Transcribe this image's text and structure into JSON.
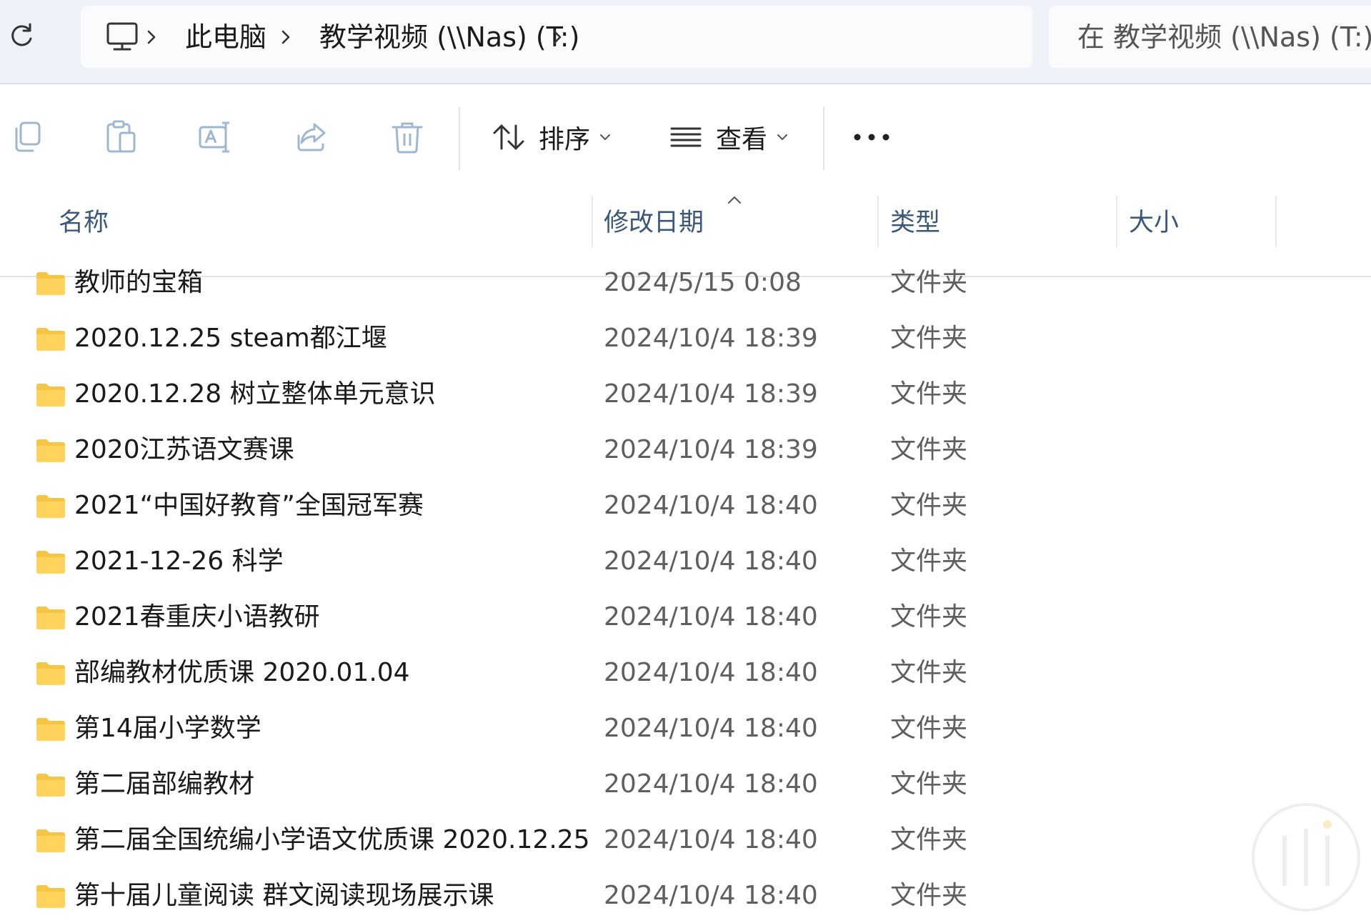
{
  "address_bar": {
    "breadcrumb": [
      "此电脑",
      "教学视频 (\\\\Nas) (T:)"
    ],
    "search_placeholder": "在 教学视频 (\\\\Nas) (T:)"
  },
  "toolbar": {
    "sort_label": "排序",
    "view_label": "查看"
  },
  "columns": {
    "name": "名称",
    "modified": "修改日期",
    "type": "类型",
    "size": "大小"
  },
  "files": [
    {
      "name": "教师的宝箱",
      "modified": "2024/5/15 0:08",
      "type": "文件夹",
      "size": ""
    },
    {
      "name": "2020.12.25 steam都江堰",
      "modified": "2024/10/4 18:39",
      "type": "文件夹",
      "size": ""
    },
    {
      "name": "2020.12.28 树立整体单元意识",
      "modified": "2024/10/4 18:39",
      "type": "文件夹",
      "size": ""
    },
    {
      "name": "2020江苏语文赛课",
      "modified": "2024/10/4 18:39",
      "type": "文件夹",
      "size": ""
    },
    {
      "name": "2021“中国好教育”全国冠军赛",
      "modified": "2024/10/4 18:40",
      "type": "文件夹",
      "size": ""
    },
    {
      "name": "2021-12-26 科学",
      "modified": "2024/10/4 18:40",
      "type": "文件夹",
      "size": ""
    },
    {
      "name": "2021春重庆小语教研",
      "modified": "2024/10/4 18:40",
      "type": "文件夹",
      "size": ""
    },
    {
      "name": "部编教材优质课 2020.01.04",
      "modified": "2024/10/4 18:40",
      "type": "文件夹",
      "size": ""
    },
    {
      "name": "第14届小学数学",
      "modified": "2024/10/4 18:40",
      "type": "文件夹",
      "size": ""
    },
    {
      "name": "第二届部编教材",
      "modified": "2024/10/4 18:40",
      "type": "文件夹",
      "size": ""
    },
    {
      "name": "第二届全国统编小学语文优质课 2020.12.25",
      "modified": "2024/10/4 18:40",
      "type": "文件夹",
      "size": ""
    },
    {
      "name": "第十届儿童阅读 群文阅读现场展示课",
      "modified": "2024/10/4 18:40",
      "type": "文件夹",
      "size": ""
    }
  ],
  "colors": {
    "address_bg": "#eef3f9",
    "header_text": "#3b5878",
    "folder_yellow": "#ffd35c",
    "secondary_text": "#5f5f5f"
  },
  "icons": {
    "refresh": "refresh-icon",
    "computer": "computer-icon",
    "copy": "copy-icon",
    "paste": "paste-icon",
    "rename": "rename-icon",
    "share": "share-icon",
    "delete": "trash-icon",
    "sort": "sort-icon",
    "view": "view-list-icon",
    "more": "more-icon",
    "folder": "folder-icon"
  }
}
